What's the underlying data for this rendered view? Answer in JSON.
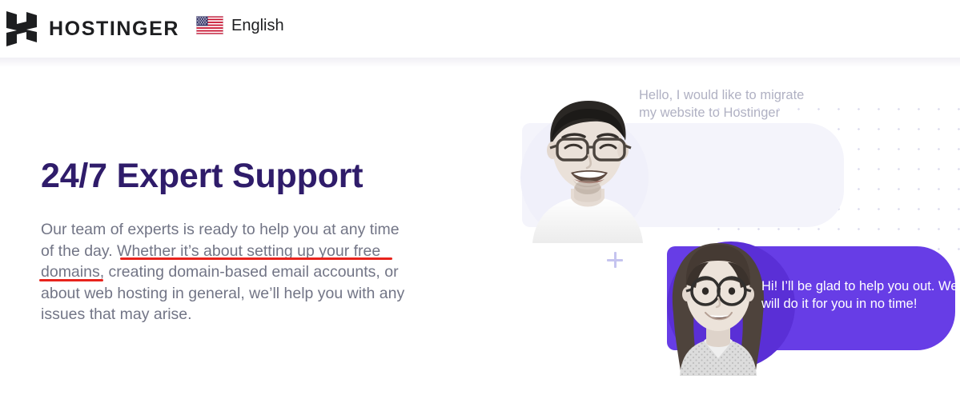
{
  "header": {
    "logo_icon": "hostinger-h-logo-icon",
    "brand_name": "HOSTINGER",
    "language": {
      "flag_icon": "us-flag-icon",
      "label": "English"
    }
  },
  "main": {
    "headline": "24/7 Expert Support",
    "body": {
      "part_before": "Our team of experts is ready to help you at any time of the day. ",
      "highlighted": "Whether it’s about setting up your free domains",
      "part_after": ", creating domain-based email accounts, or about web hosting in general, we’ll help you with any issues that may arise."
    },
    "annotation_color": "#e8231c"
  },
  "illustration": {
    "customer_message": "Hello, I would like to migrate my website to Hostinger",
    "agent_message": "Hi! I’ll be glad to help you out. We will do it for you in no time!",
    "customer_avatar": "smiling-man-with-glasses-photo",
    "agent_avatar": "smiling-woman-with-glasses-photo",
    "plus_decoration_icon": "plus-icon",
    "dot_pattern_icon": "dot-grid-pattern",
    "colors": {
      "brand_purple": "#673de6",
      "light_bubble": "#f4f4fb",
      "heading": "#2f1c6a",
      "body_text": "#727586"
    }
  }
}
